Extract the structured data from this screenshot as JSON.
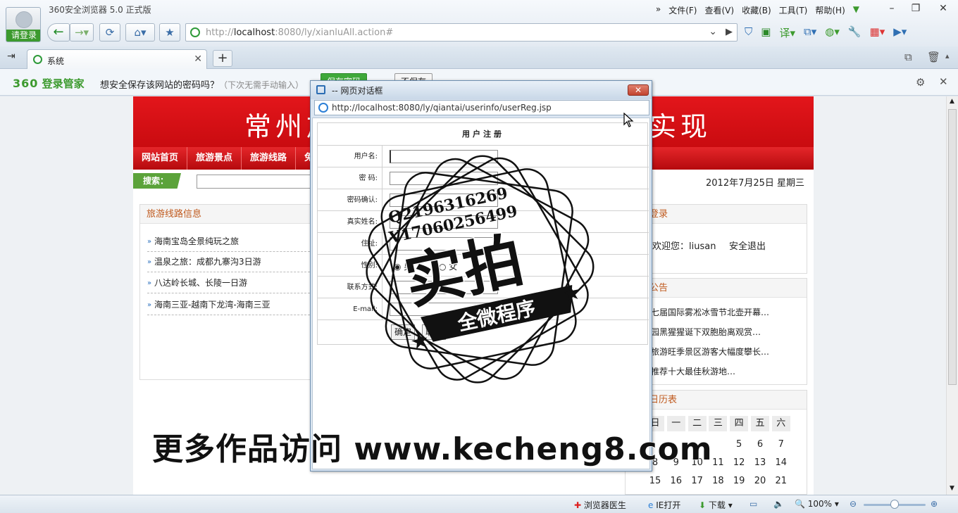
{
  "browser": {
    "title": "360安全浏览器 5.0 正式版",
    "login_label": "请登录",
    "menu": [
      "文件(F)",
      "查看(V)",
      "收藏(B)",
      "工具(T)",
      "帮助(H)"
    ],
    "address_prefix": "http://",
    "address_host": "localhost",
    "address_rest": ":8080/ly/xianluAll.action#",
    "tab_label": "系统"
  },
  "password_bar": {
    "brand": "360",
    "brand_text": "登录管家",
    "message": "想安全保存该网站的密码吗？",
    "hint": "（下次无需手动输入）",
    "save_label": "保存密码",
    "nosave_label": "不保存"
  },
  "site": {
    "banner_left": "常州旅",
    "banner_right": "实现",
    "nav": [
      "网站首页",
      "旅游景点",
      "旅游线路",
      "免费"
    ],
    "search_label": "搜索：",
    "date": "2012年7月25日 星期三",
    "left_title": "旅游线路信息",
    "routes": [
      "海南宝岛全景纯玩之旅",
      "温泉之旅：成都九寨沟3日游",
      "八达岭长城、长陵一日游",
      "海南三亚-越南下龙湾-海南三亚"
    ],
    "login_title": "登录",
    "welcome": "欢迎您：liusan",
    "logout": "安全退出",
    "notice_title": "公告",
    "notices": [
      "七届国际雾凇冰雪节北壶开幕…",
      "园黑猩猩诞下双胞胎离观赏…",
      "旅游旺季景区游客大幅度攀长…",
      "推荐十大最佳秋游地…"
    ],
    "calendar_title": "日历表",
    "weekdays": [
      "日",
      "一",
      "二",
      "三",
      "四",
      "五",
      "六"
    ],
    "week1": [
      "5",
      "6",
      "7"
    ],
    "week2": [
      "8",
      "9",
      "10",
      "11",
      "12",
      "13",
      "14"
    ],
    "week3": [
      "15",
      "16",
      "17",
      "18",
      "19",
      "20",
      "21"
    ]
  },
  "dialog": {
    "title": "-- 网页对话框",
    "url": "http://localhost:8080/ly/qiantai/userinfo/userReg.jsp",
    "form_title": "用户注册",
    "labels": [
      "用户名:",
      "密  码:",
      "密码确认:",
      "真实姓名:",
      "住址:",
      "性别:",
      "联系方式:",
      "E-mail:"
    ],
    "gender_male": "男",
    "gender_female": "女",
    "ok": "确定",
    "cancel": "取消"
  },
  "watermark": {
    "qq": "Q2196316269",
    "v": "V17060256499",
    "big": "实拍",
    "ribbon": "全微程序",
    "site": "更多作品访问 www.kecheng8.com"
  },
  "status": {
    "doctor": "浏览器医生",
    "ie": "IE打开",
    "download": "下载",
    "zoom": "100%"
  }
}
